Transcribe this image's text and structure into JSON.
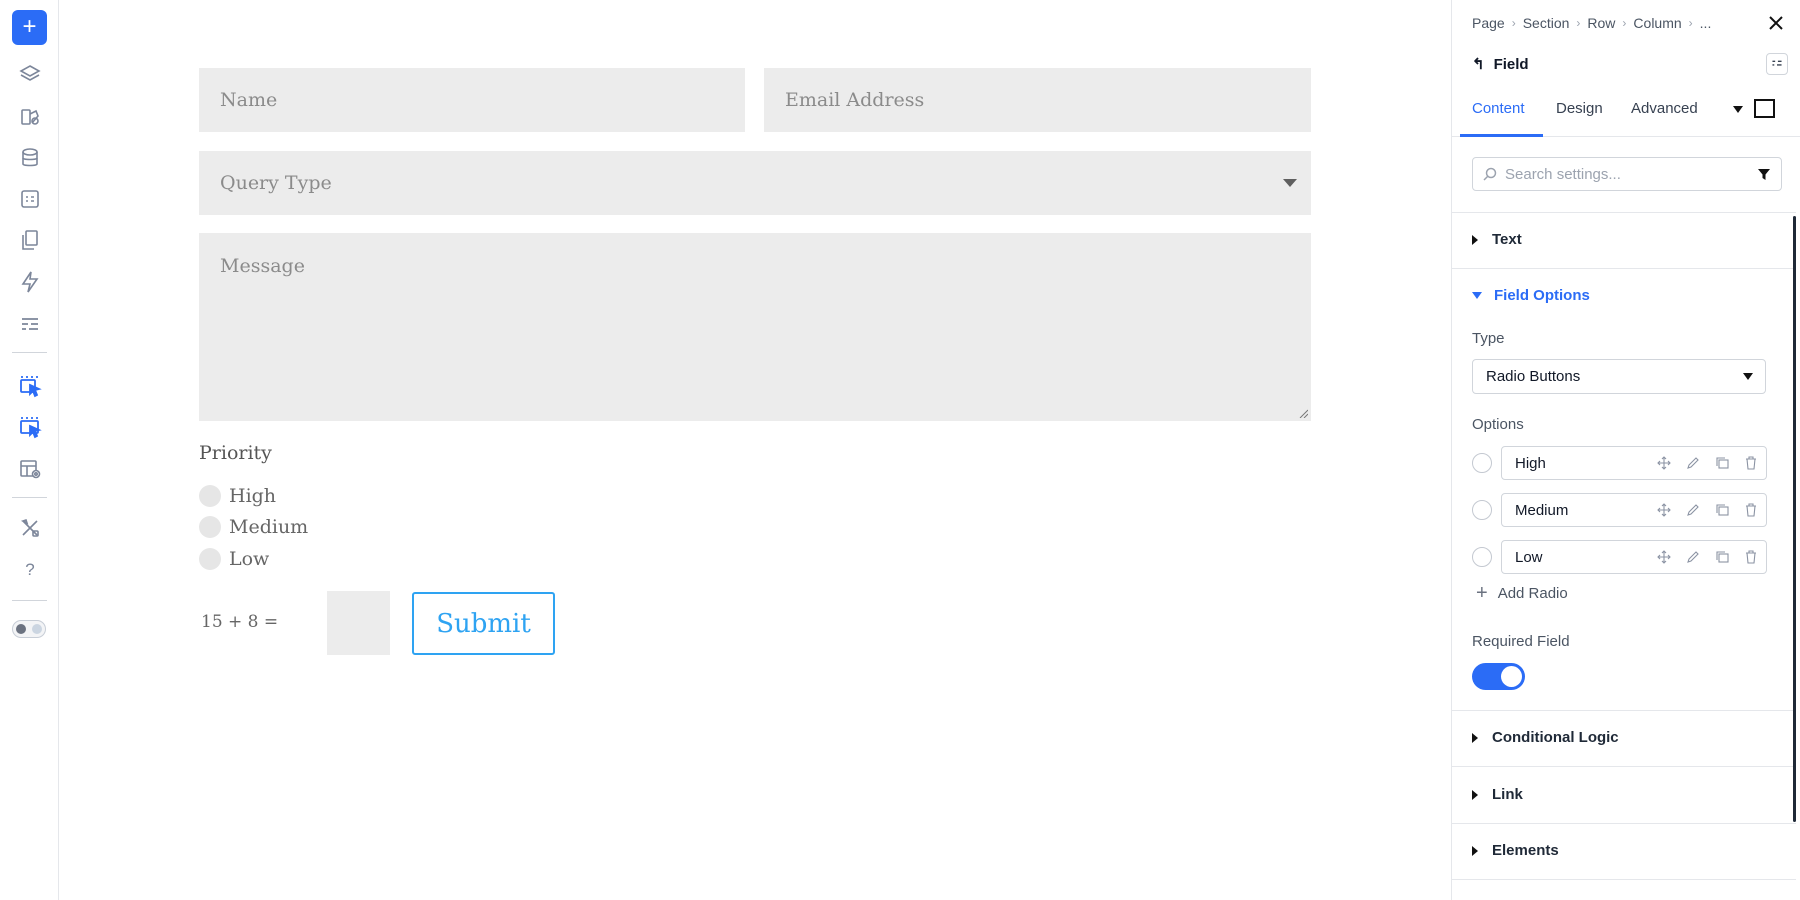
{
  "rail": {
    "add_label": "+",
    "help_label": "?",
    "icons": [
      "layers-icon",
      "brush-icon",
      "database-icon",
      "form-icon",
      "pages-icon",
      "lightning-icon",
      "list-icon",
      "select-element-icon",
      "select-element-alt-icon",
      "layout-preview-icon",
      "tools-icon",
      "help-icon",
      "theme-toggle-icon"
    ],
    "accent": "#2b6cf6"
  },
  "form": {
    "name_placeholder": "Name",
    "email_placeholder": "Email Address",
    "query_placeholder": "Query Type",
    "message_placeholder": "Message",
    "priority_label": "Priority",
    "priority_options": [
      "High",
      "Medium",
      "Low"
    ],
    "captcha_question": "15 + 8 =",
    "submit_label": "Submit",
    "submit_color": "#2ea3f2"
  },
  "panel": {
    "breadcrumbs": [
      "Page",
      "Section",
      "Row",
      "Column",
      "..."
    ],
    "element_title": "Field",
    "tabs": [
      "Content",
      "Design",
      "Advanced"
    ],
    "active_tab": "Content",
    "search_placeholder": "Search settings...",
    "sections": {
      "text": "Text",
      "field_options": "Field Options",
      "conditional_logic": "Conditional Logic",
      "link": "Link",
      "elements": "Elements"
    },
    "type_label": "Type",
    "type_value": "Radio Buttons",
    "options_label": "Options",
    "options": [
      "High",
      "Medium",
      "Low"
    ],
    "add_radio_label": "Add Radio",
    "required_label": "Required Field",
    "required_on": true
  }
}
